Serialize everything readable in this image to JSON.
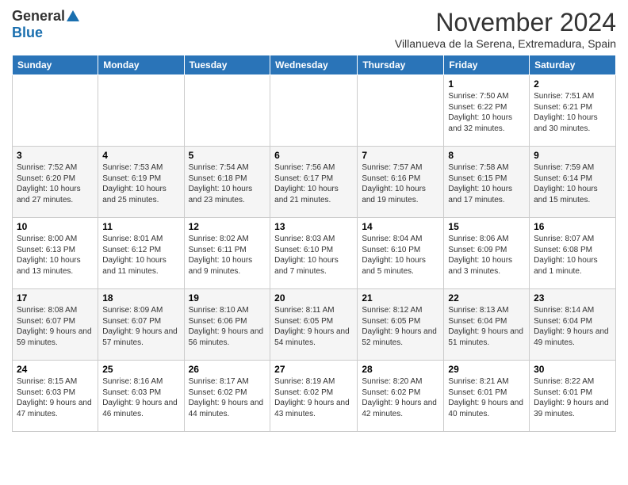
{
  "header": {
    "logo_general": "General",
    "logo_blue": "Blue",
    "month_title": "November 2024",
    "subtitle": "Villanueva de la Serena, Extremadura, Spain"
  },
  "days_of_week": [
    "Sunday",
    "Monday",
    "Tuesday",
    "Wednesday",
    "Thursday",
    "Friday",
    "Saturday"
  ],
  "weeks": [
    [
      {
        "day": "",
        "info": ""
      },
      {
        "day": "",
        "info": ""
      },
      {
        "day": "",
        "info": ""
      },
      {
        "day": "",
        "info": ""
      },
      {
        "day": "",
        "info": ""
      },
      {
        "day": "1",
        "info": "Sunrise: 7:50 AM\nSunset: 6:22 PM\nDaylight: 10 hours and 32 minutes."
      },
      {
        "day": "2",
        "info": "Sunrise: 7:51 AM\nSunset: 6:21 PM\nDaylight: 10 hours and 30 minutes."
      }
    ],
    [
      {
        "day": "3",
        "info": "Sunrise: 7:52 AM\nSunset: 6:20 PM\nDaylight: 10 hours and 27 minutes."
      },
      {
        "day": "4",
        "info": "Sunrise: 7:53 AM\nSunset: 6:19 PM\nDaylight: 10 hours and 25 minutes."
      },
      {
        "day": "5",
        "info": "Sunrise: 7:54 AM\nSunset: 6:18 PM\nDaylight: 10 hours and 23 minutes."
      },
      {
        "day": "6",
        "info": "Sunrise: 7:56 AM\nSunset: 6:17 PM\nDaylight: 10 hours and 21 minutes."
      },
      {
        "day": "7",
        "info": "Sunrise: 7:57 AM\nSunset: 6:16 PM\nDaylight: 10 hours and 19 minutes."
      },
      {
        "day": "8",
        "info": "Sunrise: 7:58 AM\nSunset: 6:15 PM\nDaylight: 10 hours and 17 minutes."
      },
      {
        "day": "9",
        "info": "Sunrise: 7:59 AM\nSunset: 6:14 PM\nDaylight: 10 hours and 15 minutes."
      }
    ],
    [
      {
        "day": "10",
        "info": "Sunrise: 8:00 AM\nSunset: 6:13 PM\nDaylight: 10 hours and 13 minutes."
      },
      {
        "day": "11",
        "info": "Sunrise: 8:01 AM\nSunset: 6:12 PM\nDaylight: 10 hours and 11 minutes."
      },
      {
        "day": "12",
        "info": "Sunrise: 8:02 AM\nSunset: 6:11 PM\nDaylight: 10 hours and 9 minutes."
      },
      {
        "day": "13",
        "info": "Sunrise: 8:03 AM\nSunset: 6:10 PM\nDaylight: 10 hours and 7 minutes."
      },
      {
        "day": "14",
        "info": "Sunrise: 8:04 AM\nSunset: 6:10 PM\nDaylight: 10 hours and 5 minutes."
      },
      {
        "day": "15",
        "info": "Sunrise: 8:06 AM\nSunset: 6:09 PM\nDaylight: 10 hours and 3 minutes."
      },
      {
        "day": "16",
        "info": "Sunrise: 8:07 AM\nSunset: 6:08 PM\nDaylight: 10 hours and 1 minute."
      }
    ],
    [
      {
        "day": "17",
        "info": "Sunrise: 8:08 AM\nSunset: 6:07 PM\nDaylight: 9 hours and 59 minutes."
      },
      {
        "day": "18",
        "info": "Sunrise: 8:09 AM\nSunset: 6:07 PM\nDaylight: 9 hours and 57 minutes."
      },
      {
        "day": "19",
        "info": "Sunrise: 8:10 AM\nSunset: 6:06 PM\nDaylight: 9 hours and 56 minutes."
      },
      {
        "day": "20",
        "info": "Sunrise: 8:11 AM\nSunset: 6:05 PM\nDaylight: 9 hours and 54 minutes."
      },
      {
        "day": "21",
        "info": "Sunrise: 8:12 AM\nSunset: 6:05 PM\nDaylight: 9 hours and 52 minutes."
      },
      {
        "day": "22",
        "info": "Sunrise: 8:13 AM\nSunset: 6:04 PM\nDaylight: 9 hours and 51 minutes."
      },
      {
        "day": "23",
        "info": "Sunrise: 8:14 AM\nSunset: 6:04 PM\nDaylight: 9 hours and 49 minutes."
      }
    ],
    [
      {
        "day": "24",
        "info": "Sunrise: 8:15 AM\nSunset: 6:03 PM\nDaylight: 9 hours and 47 minutes."
      },
      {
        "day": "25",
        "info": "Sunrise: 8:16 AM\nSunset: 6:03 PM\nDaylight: 9 hours and 46 minutes."
      },
      {
        "day": "26",
        "info": "Sunrise: 8:17 AM\nSunset: 6:02 PM\nDaylight: 9 hours and 44 minutes."
      },
      {
        "day": "27",
        "info": "Sunrise: 8:19 AM\nSunset: 6:02 PM\nDaylight: 9 hours and 43 minutes."
      },
      {
        "day": "28",
        "info": "Sunrise: 8:20 AM\nSunset: 6:02 PM\nDaylight: 9 hours and 42 minutes."
      },
      {
        "day": "29",
        "info": "Sunrise: 8:21 AM\nSunset: 6:01 PM\nDaylight: 9 hours and 40 minutes."
      },
      {
        "day": "30",
        "info": "Sunrise: 8:22 AM\nSunset: 6:01 PM\nDaylight: 9 hours and 39 minutes."
      }
    ]
  ]
}
